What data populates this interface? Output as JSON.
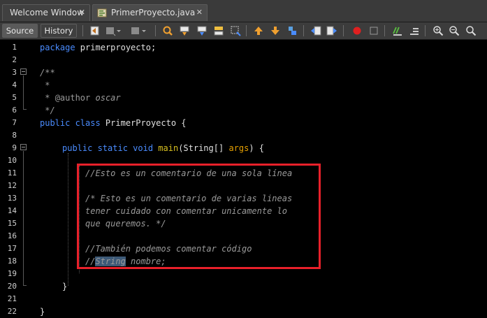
{
  "tabs": [
    {
      "label": "Welcome Window",
      "close": "✕",
      "active": false
    },
    {
      "label": "PrimerProyecto.java",
      "close": "✕",
      "active": true
    }
  ],
  "toolbar": {
    "source_label": "Source",
    "history_label": "History"
  },
  "editor": {
    "line_numbers": [
      "1",
      "2",
      "3",
      "4",
      "5",
      "6",
      "7",
      "8",
      "9",
      "10",
      "11",
      "12",
      "13",
      "14",
      "15",
      "16",
      "17",
      "18",
      "19",
      "20",
      "21",
      "22"
    ],
    "lines": {
      "l1_kw": "package",
      "l1_rest": " primerproyecto;",
      "l3": "/**",
      "l4": " *",
      "l5_star": " * ",
      "l5_tag": "@author",
      "l5_name": " oscar",
      "l6": " */",
      "l7_kw": "public class",
      "l7_rest": " PrimerProyecto {",
      "l9_kw": "public static void",
      "l9_fn": "main",
      "l9_mid": "(String[] ",
      "l9_param": "args",
      "l9_end": ") {",
      "l11": "//Esto es un comentario de una sola línea",
      "l13": "/* Esto es un comentario de varias lineas",
      "l14": "tener cuidado con comentar unicamente lo",
      "l15": "que queremos. */",
      "l17": "//También podemos comentar código",
      "l18_a": "//",
      "l18_hl": "String",
      "l18_b": " nombre;",
      "l20": "}",
      "l22": "}"
    }
  },
  "colors": {
    "keyword": "#4a8cff",
    "comment": "#9a9a9a",
    "method": "#d8c020",
    "parameter": "#e6a000",
    "annotation_box": "#e8202a",
    "selection": "#3d5a78"
  },
  "icons": [
    "last-edit-icon",
    "back-icon",
    "forward-icon",
    "find-selection-icon",
    "find-previous-icon",
    "find-next-icon",
    "toggle-highlight-icon",
    "toggle-rectangular-selection-icon",
    "previous-bookmark-icon",
    "next-bookmark-icon",
    "toggle-bookmark-icon",
    "shift-left-icon",
    "shift-right-icon",
    "start-macro-icon",
    "stop-macro-icon",
    "comment-icon",
    "uncomment-icon",
    "zoom-in-icon",
    "zoom-out-icon",
    "zoom-fit-icon"
  ]
}
